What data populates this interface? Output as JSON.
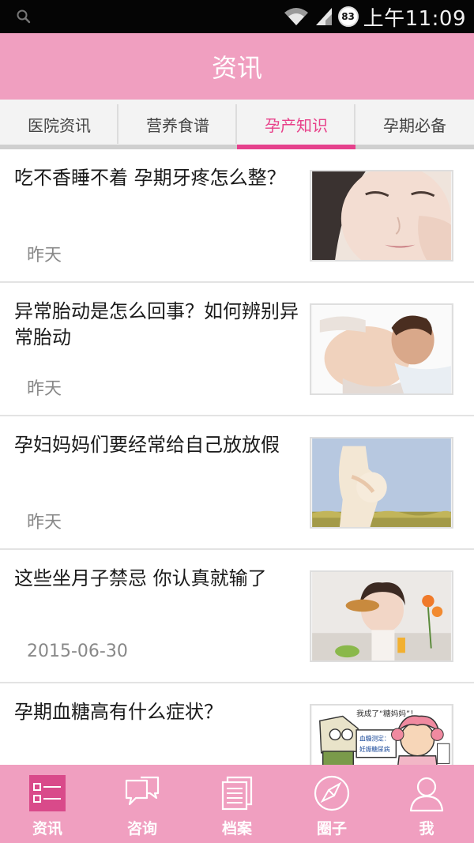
{
  "status_bar": {
    "battery_level": "83",
    "time": "上午11:09"
  },
  "header": {
    "title": "资讯"
  },
  "tabs": [
    {
      "label": "医院资讯",
      "active": false
    },
    {
      "label": "营养食谱",
      "active": false
    },
    {
      "label": "孕产知识",
      "active": true
    },
    {
      "label": "孕期必备",
      "active": false
    }
  ],
  "articles": [
    {
      "title": "吃不香睡不着 孕期牙疼怎么整？",
      "date": "昨天",
      "thumbnail": "woman-toothache-photo"
    },
    {
      "title": "异常胎动是怎么回事？如何辨别异常胎动",
      "date": "昨天",
      "thumbnail": "couple-pregnant-belly-photo"
    },
    {
      "title": "孕妇妈妈们要经常给自己放放假",
      "date": "昨天",
      "thumbnail": "pregnant-woman-field-photo"
    },
    {
      "title": "这些坐月子禁忌 你认真就输了",
      "date": "2015-06-30",
      "thumbnail": "woman-eating-bread-photo"
    },
    {
      "title": "孕期血糖高有什么症状？",
      "date": "",
      "thumbnail": "cartoon-sugar-mom-illustration"
    }
  ],
  "cartoon_text": {
    "speech": "我成了“糖妈妈”！",
    "sign_line1": "血糖测定：",
    "sign_line2": "妊娠糖尿病"
  },
  "bottom_nav": [
    {
      "label": "资讯",
      "icon": "news-list-icon",
      "active": true
    },
    {
      "label": "咨询",
      "icon": "chat-bubbles-icon",
      "active": false
    },
    {
      "label": "档案",
      "icon": "document-icon",
      "active": false
    },
    {
      "label": "圈子",
      "icon": "compass-icon",
      "active": false
    },
    {
      "label": "我",
      "icon": "person-icon",
      "active": false
    }
  ],
  "colors": {
    "brand_pink": "#f09fc0",
    "active_tab": "#e8418a",
    "active_nav_bg": "#d94a8a"
  }
}
